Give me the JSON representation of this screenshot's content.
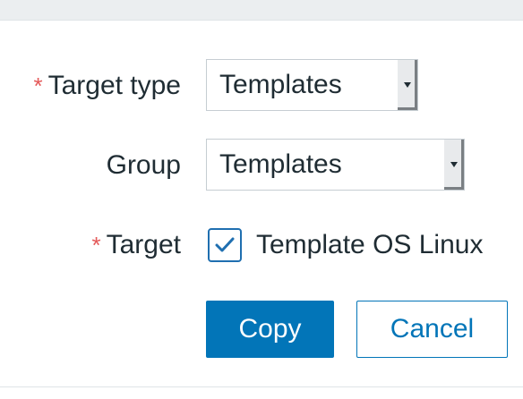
{
  "form": {
    "target_type": {
      "label": "Target type",
      "required_marker": "*",
      "value": "Templates"
    },
    "group": {
      "label": "Group",
      "value": "Templates"
    },
    "target": {
      "label": "Target",
      "required_marker": "*",
      "checkbox_label": "Template OS Linux",
      "checked": true
    }
  },
  "buttons": {
    "copy_label": "Copy",
    "cancel_label": "Cancel"
  },
  "colors": {
    "accent": "#0275b8",
    "required": "#e45959"
  },
  "icons": {
    "checkbox": "checkmark-icon",
    "select": "dropdown-arrow-icon"
  }
}
